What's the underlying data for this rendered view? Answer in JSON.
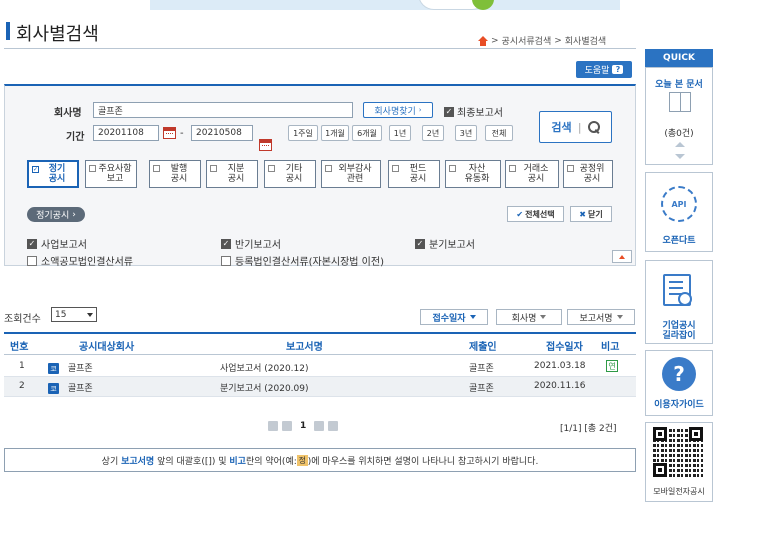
{
  "page": {
    "title": "회사별검색",
    "breadcrumb": [
      "공시서류검색",
      "회사별검색"
    ],
    "breadcrumb_sep": ">",
    "help_label": "도움말"
  },
  "search": {
    "company_label": "회사명",
    "company_value": "골프존",
    "find_company_label": "회사명찾기",
    "latest_report_label": "최종보고서",
    "latest_report_checked": true,
    "period_label": "기간",
    "start_date": "20201108",
    "end_date": "20210508",
    "date_sep": "-",
    "ranges": [
      "1주일",
      "1개월",
      "6개월",
      "1년",
      "2년",
      "3년",
      "전체"
    ],
    "search_label": "검색"
  },
  "categories": [
    {
      "label": "정기\n공시",
      "checked": true
    },
    {
      "label": "주요사항\n보고",
      "checked": false
    },
    {
      "label": "발행\n공시",
      "checked": false
    },
    {
      "label": "지분\n공시",
      "checked": false
    },
    {
      "label": "기타\n공시",
      "checked": false
    },
    {
      "label": "외부감사\n관련",
      "checked": false
    },
    {
      "label": "펀드\n공시",
      "checked": false
    },
    {
      "label": "자산\n유동화",
      "checked": false
    },
    {
      "label": "거래소\n공시",
      "checked": false
    },
    {
      "label": "공정위\n공시",
      "checked": false
    }
  ],
  "subsection": {
    "pill_label": "정기공시",
    "select_all_label": "전체선택",
    "close_label": "닫기",
    "options": [
      {
        "label": "사업보고서",
        "checked": true
      },
      {
        "label": "반기보고서",
        "checked": true
      },
      {
        "label": "분기보고서",
        "checked": true
      },
      {
        "label": "소액공모법인결산서류",
        "checked": false
      },
      {
        "label": "등록법인결산서류(자본시장법 이전)",
        "checked": false
      }
    ]
  },
  "results": {
    "count_label": "조회건수",
    "count_value": "15",
    "sort_buttons": [
      "접수일자",
      "회사명",
      "보고서명"
    ],
    "columns": [
      "번호",
      "공시대상회사",
      "보고서명",
      "제출인",
      "접수일자",
      "비고"
    ],
    "rows": [
      {
        "no": "1",
        "corp_badge": "코",
        "company": "골프존",
        "report": "사업보고서 (2020.12)",
        "filer": "골프존",
        "date": "2021.03.18",
        "note": "연"
      },
      {
        "no": "2",
        "corp_badge": "코",
        "company": "골프존",
        "report": "분기보고서 (2020.09)",
        "filer": "골프존",
        "date": "2020.11.16",
        "note": ""
      }
    ],
    "current_page": "1",
    "page_info": "[1/1] [총 2건]",
    "notice_parts": [
      "상기 ",
      "보고서명",
      " 앞의 대괄호([]) 및 ",
      "비고",
      "란의 약어(예:",
      "정",
      ")에 마우스를 위치하면 설명이 나타나니 참고하시기 바랍니다."
    ]
  },
  "quick": {
    "head": "QUICK",
    "today_docs": "오늘 본 문서",
    "today_count": "(총0건)",
    "open_dart": "오픈다트",
    "api_text": "API",
    "company_guide": "기업공시\n길라잡이",
    "user_guide": "이용자가이드",
    "mobile": "모바일전자공시"
  },
  "icons": {
    "home": "home-icon",
    "calendar": "calendar-icon",
    "search": "magnifier-icon",
    "help": "question-icon"
  },
  "colors": {
    "accent": "#1a63b5",
    "home": "#e84e26",
    "note_badge": "#2e9a46"
  }
}
